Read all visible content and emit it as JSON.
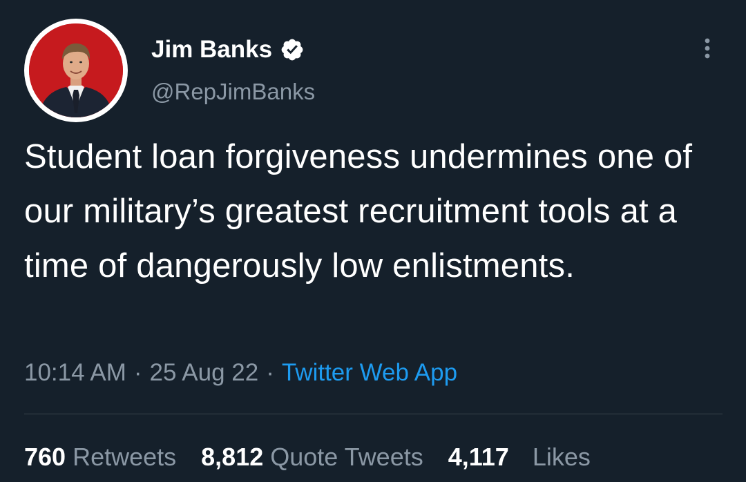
{
  "user": {
    "display_name": "Jim Banks",
    "handle": "@RepJimBanks",
    "verified": true,
    "avatar_icon": "profile-photo"
  },
  "tweet": {
    "text": "Student loan forgiveness undermines one of our military’s greatest recruitment tools at a time of dangerously low enlistments.",
    "time": "10:14 AM",
    "date": "25 Aug 22",
    "separator": "·",
    "source": "Twitter Web App"
  },
  "stats": {
    "retweets": {
      "count": "760",
      "label": "Retweets"
    },
    "quote_tweets": {
      "count": "8,812",
      "label": "Quote Tweets"
    },
    "likes": {
      "count": "4,117",
      "label": "Likes"
    }
  },
  "colors": {
    "background": "#15202b",
    "text_primary": "#ffffff",
    "text_secondary": "#8b98a5",
    "link": "#1d9bf0",
    "divider": "#38444d",
    "avatar_bg": "#c61a1e"
  },
  "icons": {
    "verified": "verified-badge-icon",
    "more": "more-vertical-icon"
  }
}
